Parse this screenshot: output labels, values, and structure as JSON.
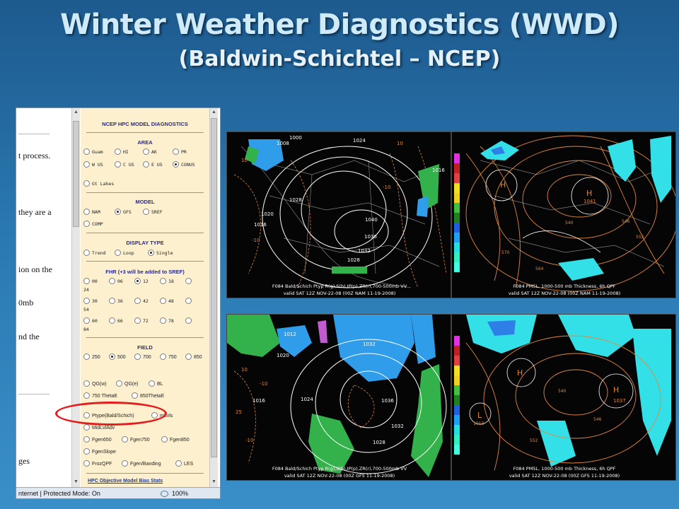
{
  "slide": {
    "title": "Winter Weather Diagnostics (WWD)",
    "subtitle": "(Baldwin-Schichtel – NCEP)"
  },
  "browser": {
    "left_fragments": [
      "t process.",
      "they are a",
      "ion on the",
      "0mb",
      "nd the",
      "ges"
    ],
    "status_text": "nternet | Protected Mode: On",
    "zoom": "100%",
    "panel": {
      "title": "NCEP HPC MODEL DIAGNOSTICS",
      "area": {
        "heading": "AREA",
        "options": [
          "Guam",
          "HI",
          "AK",
          "PR",
          "W US",
          "C US",
          "E US",
          "CONUS",
          "Gt Lakes"
        ],
        "selected": "CONUS"
      },
      "model": {
        "heading": "MODEL",
        "options": [
          "NAM",
          "GFS",
          "SREF",
          "COMP"
        ],
        "selected": "GFS"
      },
      "display_type": {
        "heading": "DISPLAY TYPE",
        "options": [
          "Trend",
          "Loop",
          "Single"
        ],
        "selected": "Single"
      },
      "fhr": {
        "heading": "FHR (+3 will be added to SREF)",
        "options": [
          "00",
          "06",
          "12",
          "18",
          "24",
          "30",
          "36",
          "42",
          "48",
          "54",
          "60",
          "66",
          "72",
          "78",
          "84"
        ],
        "selected": "12"
      },
      "field": {
        "heading": "FIELD",
        "levels": [
          "250",
          "500",
          "700",
          "750",
          "850"
        ],
        "selected_level": "500",
        "options": [
          "QG(w)",
          "QG(e)",
          "BL",
          "750 ThetaE",
          "850ThetaE",
          "Ptype(Bald/Schich)",
          "mLvls",
          "MidLvlAdv",
          "Fgen650",
          "Fgen750",
          "Fgen850",
          "FgenSlope",
          "FrozQPF",
          "Fgen/Banding",
          "LES"
        ]
      },
      "bias_link": "HPC Objective Model Bias Stats"
    }
  },
  "maps": [
    {
      "line1": "F084 Bald/Schich Ptyp R(g),S(b),IP(p),ZR(r),700-500mb VV",
      "line2": "valid SAT 12Z NOV-22-08 (00Z NAM 11-19-2008)",
      "labels": [
        "1024",
        "1028",
        "1020",
        "1016",
        "1040",
        "1036",
        "1032",
        "1028",
        "1016",
        "1008",
        "1000",
        "10",
        "-10",
        "10",
        "-10"
      ]
    },
    {
      "line1": "F084 PMSL, 1000-500 mb Thickness, 6h QPF",
      "line2": "valid SAT 12Z NOV-22-08 (00Z NAM 11-19-2008)",
      "labels": [
        "H",
        "1041",
        "H",
        "546",
        "540",
        "552",
        "570",
        "564"
      ]
    },
    {
      "line1": "F084 Bald/Schich Ptyp R(g),S(b),IP(p),ZR(r),700-500mb VV",
      "line2": "valid SAT 12Z NOV-22-08 (00Z GFS 11-19-2008)",
      "labels": [
        "1032",
        "1024",
        "1020",
        "1016",
        "1036",
        "1032",
        "1028",
        "1012",
        "10",
        "-10",
        "-10",
        "25"
      ]
    },
    {
      "line1": "F084 PMSL, 1000-500 mb Thickness, 6h QPF",
      "line2": "valid SAT 12Z NOV-22-08 (00Z GFS 11-19-2008)",
      "labels": [
        "H",
        "1037",
        "H",
        "L",
        "1013",
        "540",
        "546",
        "552"
      ]
    }
  ],
  "colors": {
    "highlight_oval": "#e41e1e",
    "panel_bg": "#fdf0cf",
    "map_contour": "#e0873c"
  }
}
